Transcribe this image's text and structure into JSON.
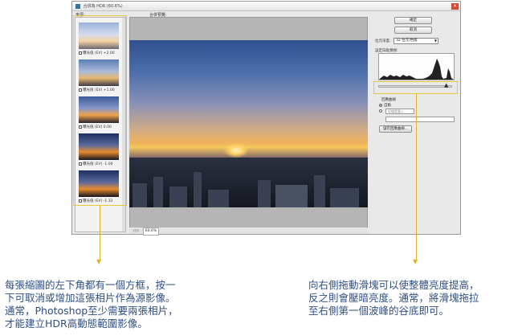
{
  "window": {
    "title": "合併為 HDR (60.6%)",
    "close": "×"
  },
  "labels": {
    "source": "來源:",
    "preview": "合併預覽:"
  },
  "thumbnails": [
    {
      "caption": "曝光值 (EV) +2.00",
      "checked": true
    },
    {
      "caption": "曝光值 (EV) +1.00",
      "checked": true
    },
    {
      "caption": "曝光值 (EV) 0.00",
      "checked": true
    },
    {
      "caption": "曝光值 (EV) -1.00",
      "checked": true
    },
    {
      "caption": "曝光值 (EV) -1.32",
      "checked": true
    }
  ],
  "statusbar": {
    "icons": "◁ ▷",
    "zoom": "60.6%"
  },
  "controls": {
    "ok": "確定",
    "cancel": "取消",
    "bit_depth_label": "位元深度:",
    "bit_depth_value": "32 位元/色版",
    "white_point_label": "設定白點預視:",
    "response_curve_label": "回應曲線",
    "auto_label": "自動",
    "save_label": "",
    "load_placeholder": "從檔案載入...",
    "save_button": "儲存回應曲線..."
  },
  "annotations": {
    "left": [
      "每張縮圖的左下角都有一個方框，按一",
      "下可取消或增加這張相片作為源影像。",
      "通常，Photoshop至少需要兩張相片，",
      "才能建立HDR高動態範圍影像。"
    ],
    "right": [
      "向右側拖動滑塊可以使整體亮度提高，",
      "反之則會壓暗亮度。通常，將滑塊拖拉",
      "至右側第一個波峰的谷底即可。"
    ]
  },
  "colors": {
    "highlight": "#e6c83a",
    "annotation_text": "#2f4f83"
  }
}
